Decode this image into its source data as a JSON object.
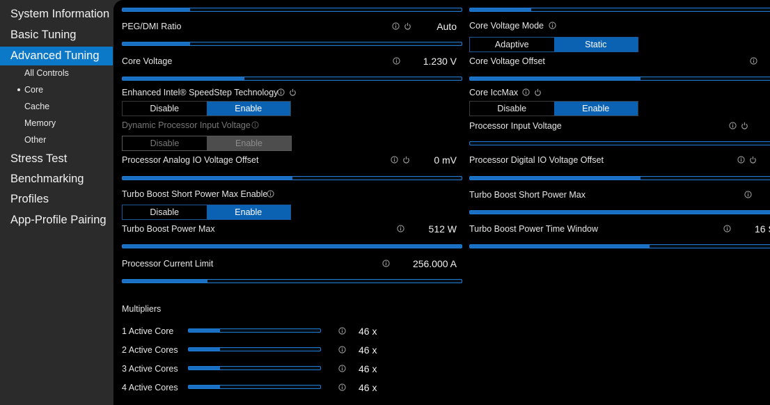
{
  "sidebar": {
    "items": [
      {
        "label": "System Information"
      },
      {
        "label": "Basic Tuning"
      },
      {
        "label": "Advanced Tuning"
      },
      {
        "label": "Stress Test"
      },
      {
        "label": "Benchmarking"
      },
      {
        "label": "Profiles"
      },
      {
        "label": "App-Profile Pairing"
      }
    ],
    "subitems": [
      {
        "label": "All Controls"
      },
      {
        "label": "Core"
      },
      {
        "label": "Cache"
      },
      {
        "label": "Memory"
      },
      {
        "label": "Other"
      }
    ],
    "active_item": "Advanced Tuning",
    "active_subitem": "Core"
  },
  "colors": {
    "accent": "#0c78c8",
    "slider_border": "#1f7fd6",
    "toggle_on": "#0c62b2"
  },
  "left": {
    "peg_dmi": {
      "label": "PEG/DMI Ratio",
      "value": "Auto",
      "level": 0.2
    },
    "core_voltage": {
      "label": "Core Voltage",
      "value": "1.230 V",
      "level": 0.36
    },
    "speedstep": {
      "label": "Enhanced Intel® SpeedStep Technology",
      "opt1": "Disable",
      "opt2": "Enable",
      "selected": "Enable"
    },
    "dyn_input_voltage": {
      "label": "Dynamic Processor Input Voltage",
      "opt1": "Disable",
      "opt2": "Enable",
      "selected": "Enable",
      "disabled": true
    },
    "analog_io": {
      "label": "Processor Analog IO Voltage Offset",
      "value": "0 mV",
      "level": 0.5
    },
    "turbo_short_enable": {
      "label": "Turbo Boost Short Power Max Enable",
      "opt1": "Disable",
      "opt2": "Enable",
      "selected": "Enable"
    },
    "turbo_power_max": {
      "label": "Turbo Boost Power Max",
      "value": "512 W",
      "level": 1.0
    },
    "current_limit": {
      "label": "Processor Current Limit",
      "value": "256.000 A",
      "level": 0.25
    }
  },
  "right": {
    "voltage_mode": {
      "label": "Core Voltage Mode",
      "opt1": "Adaptive",
      "opt2": "Static",
      "selected": "Static"
    },
    "voltage_offset": {
      "label": "Core Voltage Offset",
      "level": 0.56
    },
    "iccmax": {
      "label": "Core IccMax",
      "opt1": "Disable",
      "opt2": "Enable",
      "selected": "Enable"
    },
    "input_voltage": {
      "label": "Processor Input Voltage",
      "level": 0.0
    },
    "digital_io": {
      "label": "Processor Digital IO Voltage Offset",
      "level": 0.56
    },
    "turbo_short_max": {
      "label": "Turbo Boost Short Power Max",
      "level": 1.0
    },
    "turbo_time_window": {
      "label": "Turbo Boost Power Time Window",
      "value": "16 S",
      "level": 0.59
    }
  },
  "multipliers": {
    "title": "Multipliers",
    "rows": [
      {
        "label": "1 Active Core",
        "value": "46 x",
        "level": 0.24
      },
      {
        "label": "2 Active Cores",
        "value": "46 x",
        "level": 0.24
      },
      {
        "label": "3 Active Cores",
        "value": "46 x",
        "level": 0.24
      },
      {
        "label": "4 Active Cores",
        "value": "46 x",
        "level": 0.24
      }
    ]
  }
}
